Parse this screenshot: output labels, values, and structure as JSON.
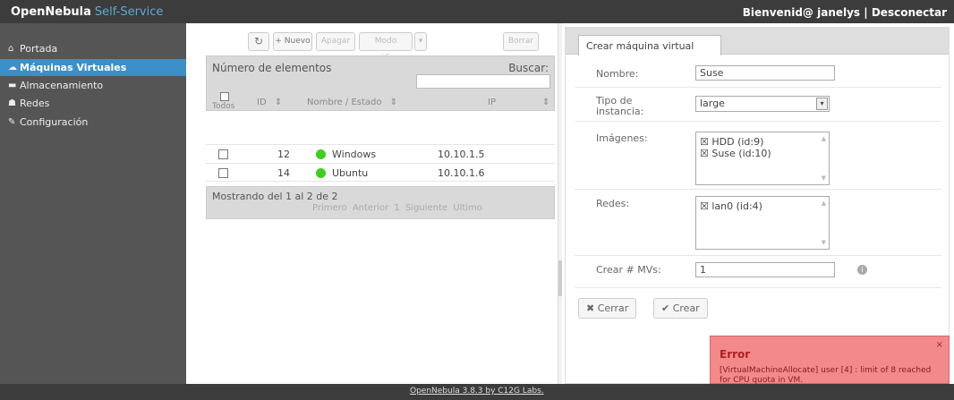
{
  "header": {
    "brand_main": "OpenNebula",
    "brand_accent": "Self-Service",
    "welcome": "Bienvenid@ janelys",
    "separator": "|",
    "logout": "Desconectar"
  },
  "sidebar": {
    "items": [
      {
        "icon": "home-icon",
        "glyph": "⌂",
        "label": "Portada",
        "active": false
      },
      {
        "icon": "cloud-icon",
        "glyph": "☁",
        "label": "Máquinas Virtuales",
        "active": true
      },
      {
        "icon": "folder-icon",
        "glyph": "▬",
        "label": "Almacenamiento",
        "active": false
      },
      {
        "icon": "network-icon",
        "glyph": "☗",
        "label": "Redes",
        "active": false
      },
      {
        "icon": "wrench-icon",
        "glyph": "✎",
        "label": "Configuración",
        "active": false
      }
    ]
  },
  "toolbar": {
    "refresh_glyph": "↻",
    "new_label": "+ Nuevo",
    "shutdown_label": "Apagar",
    "more_label": "Modo gráfico",
    "more_arrow": "▾",
    "delete_label": "Borrar"
  },
  "grid": {
    "count_label": "Número de elementos",
    "search_label": "Buscar:",
    "columns": {
      "all": "Todos",
      "id": "ID",
      "name_state": "Nombre / Estado",
      "ip": "IP",
      "sort_glyph": "⇕"
    },
    "rows": [
      {
        "id": "12",
        "name": "Windows",
        "ip": "10.10.1.5"
      },
      {
        "id": "14",
        "name": "Ubuntu",
        "ip": "10.10.1.6"
      }
    ],
    "showing": "Mostrando del 1 al 2 de 2",
    "pager": "Primero  Anterior  1  Siguiente  Último"
  },
  "dialog": {
    "tab": "Crear máquina virtual",
    "name_label": "Nombre:",
    "name_value": "Suse",
    "type_label_1": "Tipo de",
    "type_label_2": "instancia:",
    "type_value": "large",
    "images_label": "Imágenes:",
    "images": [
      "☒ HDD (id:9)",
      "☒ Suse (id:10)"
    ],
    "networks_label": "Redes:",
    "networks": [
      "☒ lan0 (id:4)"
    ],
    "count_label": "Crear # MVs:",
    "count_value": "1",
    "close_label": "✖ Cerrar",
    "create_label": "✔ Crear"
  },
  "error": {
    "title": "Error",
    "message": "[VirtualMachineAllocate] user [4] : limit of 8 reached for CPU quota in VM.",
    "close_glyph": "×"
  },
  "footer": {
    "text": "OpenNebula 3.8.3 by C12G Labs."
  }
}
